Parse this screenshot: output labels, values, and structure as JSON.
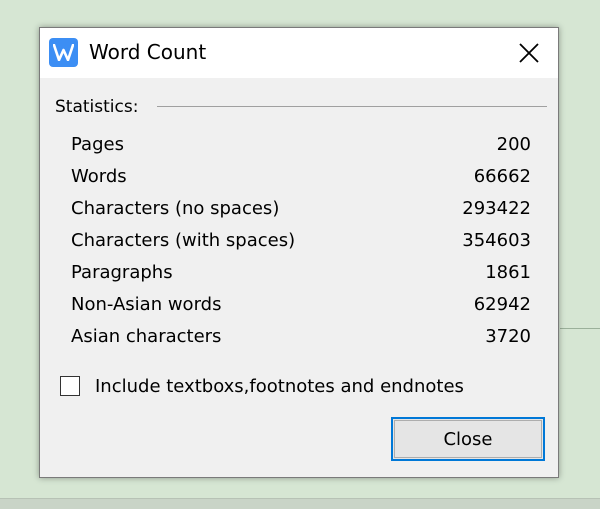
{
  "window": {
    "title": "Word Count",
    "app_icon": "wps-writer-icon",
    "close_icon": "close-icon"
  },
  "statistics": {
    "label": "Statistics:",
    "rows": [
      {
        "label": "Pages",
        "value": "200"
      },
      {
        "label": "Words",
        "value": "66662"
      },
      {
        "label": "Characters (no spaces)",
        "value": "293422"
      },
      {
        "label": "Characters (with spaces)",
        "value": "354603"
      },
      {
        "label": "Paragraphs",
        "value": "1861"
      },
      {
        "label": "Non-Asian words",
        "value": "62942"
      },
      {
        "label": "Asian characters",
        "value": "3720"
      }
    ]
  },
  "options": {
    "include_label": "Include textboxs,footnotes and endnotes",
    "include_checked": false
  },
  "buttons": {
    "close_label": "Close"
  },
  "colors": {
    "accent": "#0078d7",
    "app_icon_bg": "#3c8ef4",
    "desktop_bg": "#d6e6d3"
  }
}
